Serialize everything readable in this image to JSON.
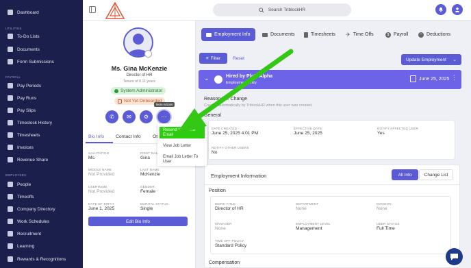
{
  "sidebar": {
    "items": [
      {
        "label": "Dashboard",
        "icon": "dashboard-icon"
      },
      {
        "label": "To-Do Lists",
        "icon": "list-icon"
      },
      {
        "label": "Documents",
        "icon": "folder-icon"
      },
      {
        "label": "Form Submissions",
        "icon": "form-icon"
      },
      {
        "label": "Pay Periods",
        "icon": "calendar-icon"
      },
      {
        "label": "Pay Runs",
        "icon": "payrun-icon"
      },
      {
        "label": "Pay Slips",
        "icon": "payslip-icon"
      },
      {
        "label": "Timeclock History",
        "icon": "clock-icon"
      },
      {
        "label": "Timesheets",
        "icon": "timesheet-icon"
      },
      {
        "label": "Invoices",
        "icon": "invoice-icon"
      },
      {
        "label": "Revenue Share",
        "icon": "revenue-icon"
      },
      {
        "label": "People",
        "icon": "people-icon"
      },
      {
        "label": "Timeoffs",
        "icon": "plane-icon"
      },
      {
        "label": "Company Directory",
        "icon": "directory-icon"
      },
      {
        "label": "Work Schedules",
        "icon": "schedule-icon"
      },
      {
        "label": "Recruitment",
        "icon": "recruit-icon"
      },
      {
        "label": "Learning",
        "icon": "learning-icon"
      },
      {
        "label": "Rewards & Recognitions",
        "icon": "rewards-icon"
      }
    ],
    "sections": {
      "utilities": "UTILITIES",
      "payroll": "PAYROLL",
      "employees": "EMPLOYEES"
    }
  },
  "topbar": {
    "search_placeholder": "Search TriblockHR"
  },
  "profile": {
    "name": "Ms. Gina McKenzie",
    "role": "Director of HR",
    "tenure": "Tenure of 0.11 years",
    "badge_admin": "System Administrator",
    "badge_onboard": "Not Yet Onboarded",
    "tooltip": "More Actions",
    "tabs": [
      "Bio Info",
      "Contact Info",
      "Ot"
    ],
    "fields": {
      "salutation_label": "SALUTATION",
      "salutation": "Ms.",
      "first_label": "FIRST NAME",
      "first": "Gina",
      "middle_label": "MIDDLE NAME",
      "middle": "Not Provided",
      "last_label": "LAST NAME",
      "last": "McKenzie",
      "username_label": "USERNAME",
      "username": "Not Provided",
      "gender_label": "GENDER",
      "gender": "Female",
      "dob_label": "DATE OF BIRTH",
      "dob": "June 1, 2025",
      "marital_label": "MARITAL STATUS",
      "marital": "Single"
    },
    "edit_button": "Edit Bio Info"
  },
  "menu": {
    "items": [
      "Resend Welcome Email",
      "View Job Letter",
      "Email Job Letter To User"
    ]
  },
  "main": {
    "tabs": [
      {
        "label": "Employment Info",
        "icon": "briefcase-icon"
      },
      {
        "label": "Documents",
        "icon": "folder-icon"
      },
      {
        "label": "Timesheets",
        "icon": "timesheet-icon"
      },
      {
        "label": "Time Offs",
        "icon": "plane-icon"
      },
      {
        "label": "Payroll",
        "icon": "dollar-icon"
      },
      {
        "label": "Deductions",
        "icon": "minus-icon"
      }
    ],
    "filter": "Filter",
    "reset": "Reset",
    "update": "Update Employment",
    "banner_title": "Hired by Plato Alpha",
    "banner_sub": "Employment Entry",
    "banner_date": "June 25, 2025",
    "reason_title": "Reason For Change",
    "reason_sub": "Created automatically by TriblockHR when this user was created.",
    "general": "General",
    "general_fields": {
      "date_created_label": "DATE CREATED",
      "date_created": "June 25, 2025 4:01 PM",
      "effective_label": "EFFECTIVE DATE",
      "effective": "June 25, 2025",
      "notify_label": "NOTIFY AFFECTED USER",
      "notify": "Yes",
      "notify_other_label": "NOTIFY OTHER USERS",
      "notify_other": "No"
    },
    "emp_info": "Employment Information",
    "all_info": "All Info",
    "change_list": "Change List",
    "position": "Position",
    "position_fields": {
      "title_label": "WORK TITLE",
      "title": "Director of HR",
      "dept_label": "DEPARTMENT",
      "dept": "None",
      "division_label": "DIVISION",
      "division": "None",
      "manager_label": "MANAGER",
      "manager": "None",
      "level_label": "EMPLOYMENT LEVEL",
      "level": "Management",
      "status_label": "USER STATUS",
      "status": "Full Time",
      "policy_label": "TIME OFF POLICY",
      "policy": "Standard Policy"
    },
    "compensation": "Compensation"
  },
  "colors": {
    "primary": "#5b5bd6",
    "sidebar": "#1b1f4b",
    "highlight": "#2ecc0f",
    "arrow": "#34c716"
  }
}
